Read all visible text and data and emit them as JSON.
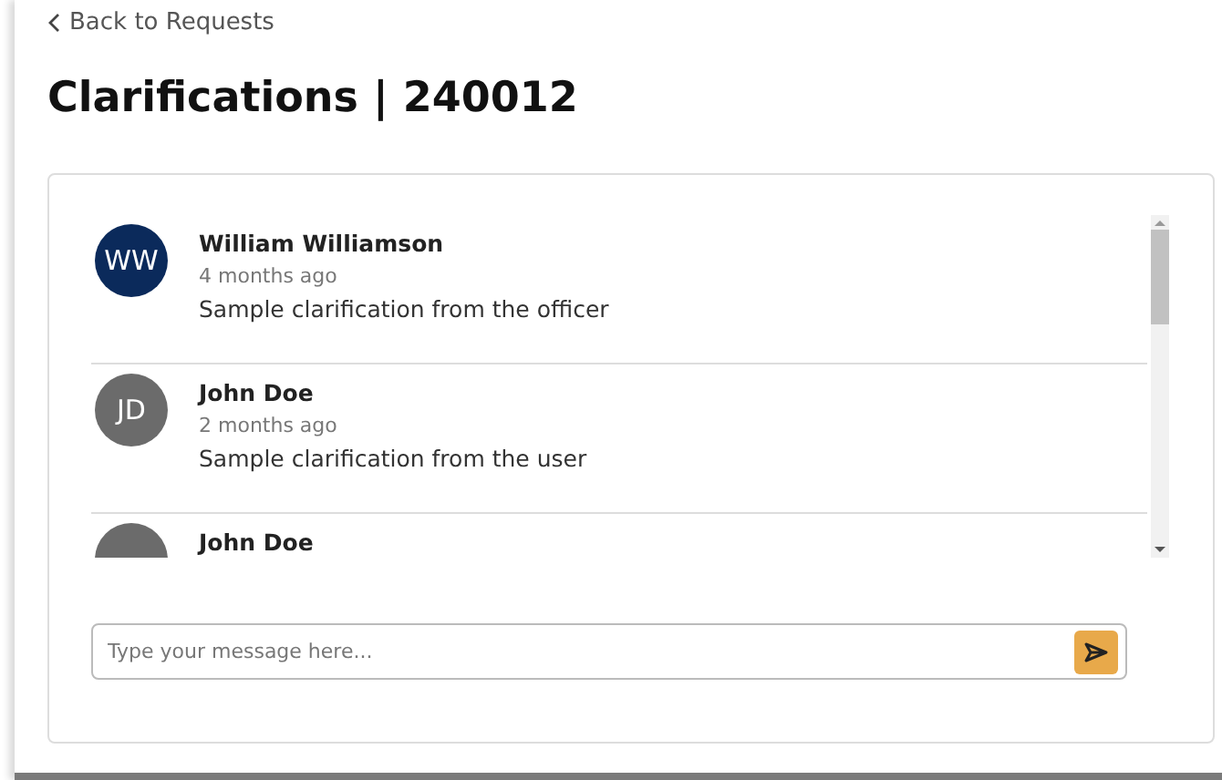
{
  "back_link": "Back to Requests",
  "title": "Clarifications | 240012",
  "messages": [
    {
      "initials": "WW",
      "color": "#0b2a5b",
      "author": "William Williamson",
      "time": "4 months ago",
      "text": "Sample clarification from the officer"
    },
    {
      "initials": "JD",
      "color": "#6b6b6b",
      "author": "John Doe",
      "time": "2 months ago",
      "text": "Sample clarification from the user"
    },
    {
      "color": "#6b6b6b",
      "author": "John Doe"
    }
  ],
  "composer": {
    "placeholder": "Type your message here..."
  }
}
